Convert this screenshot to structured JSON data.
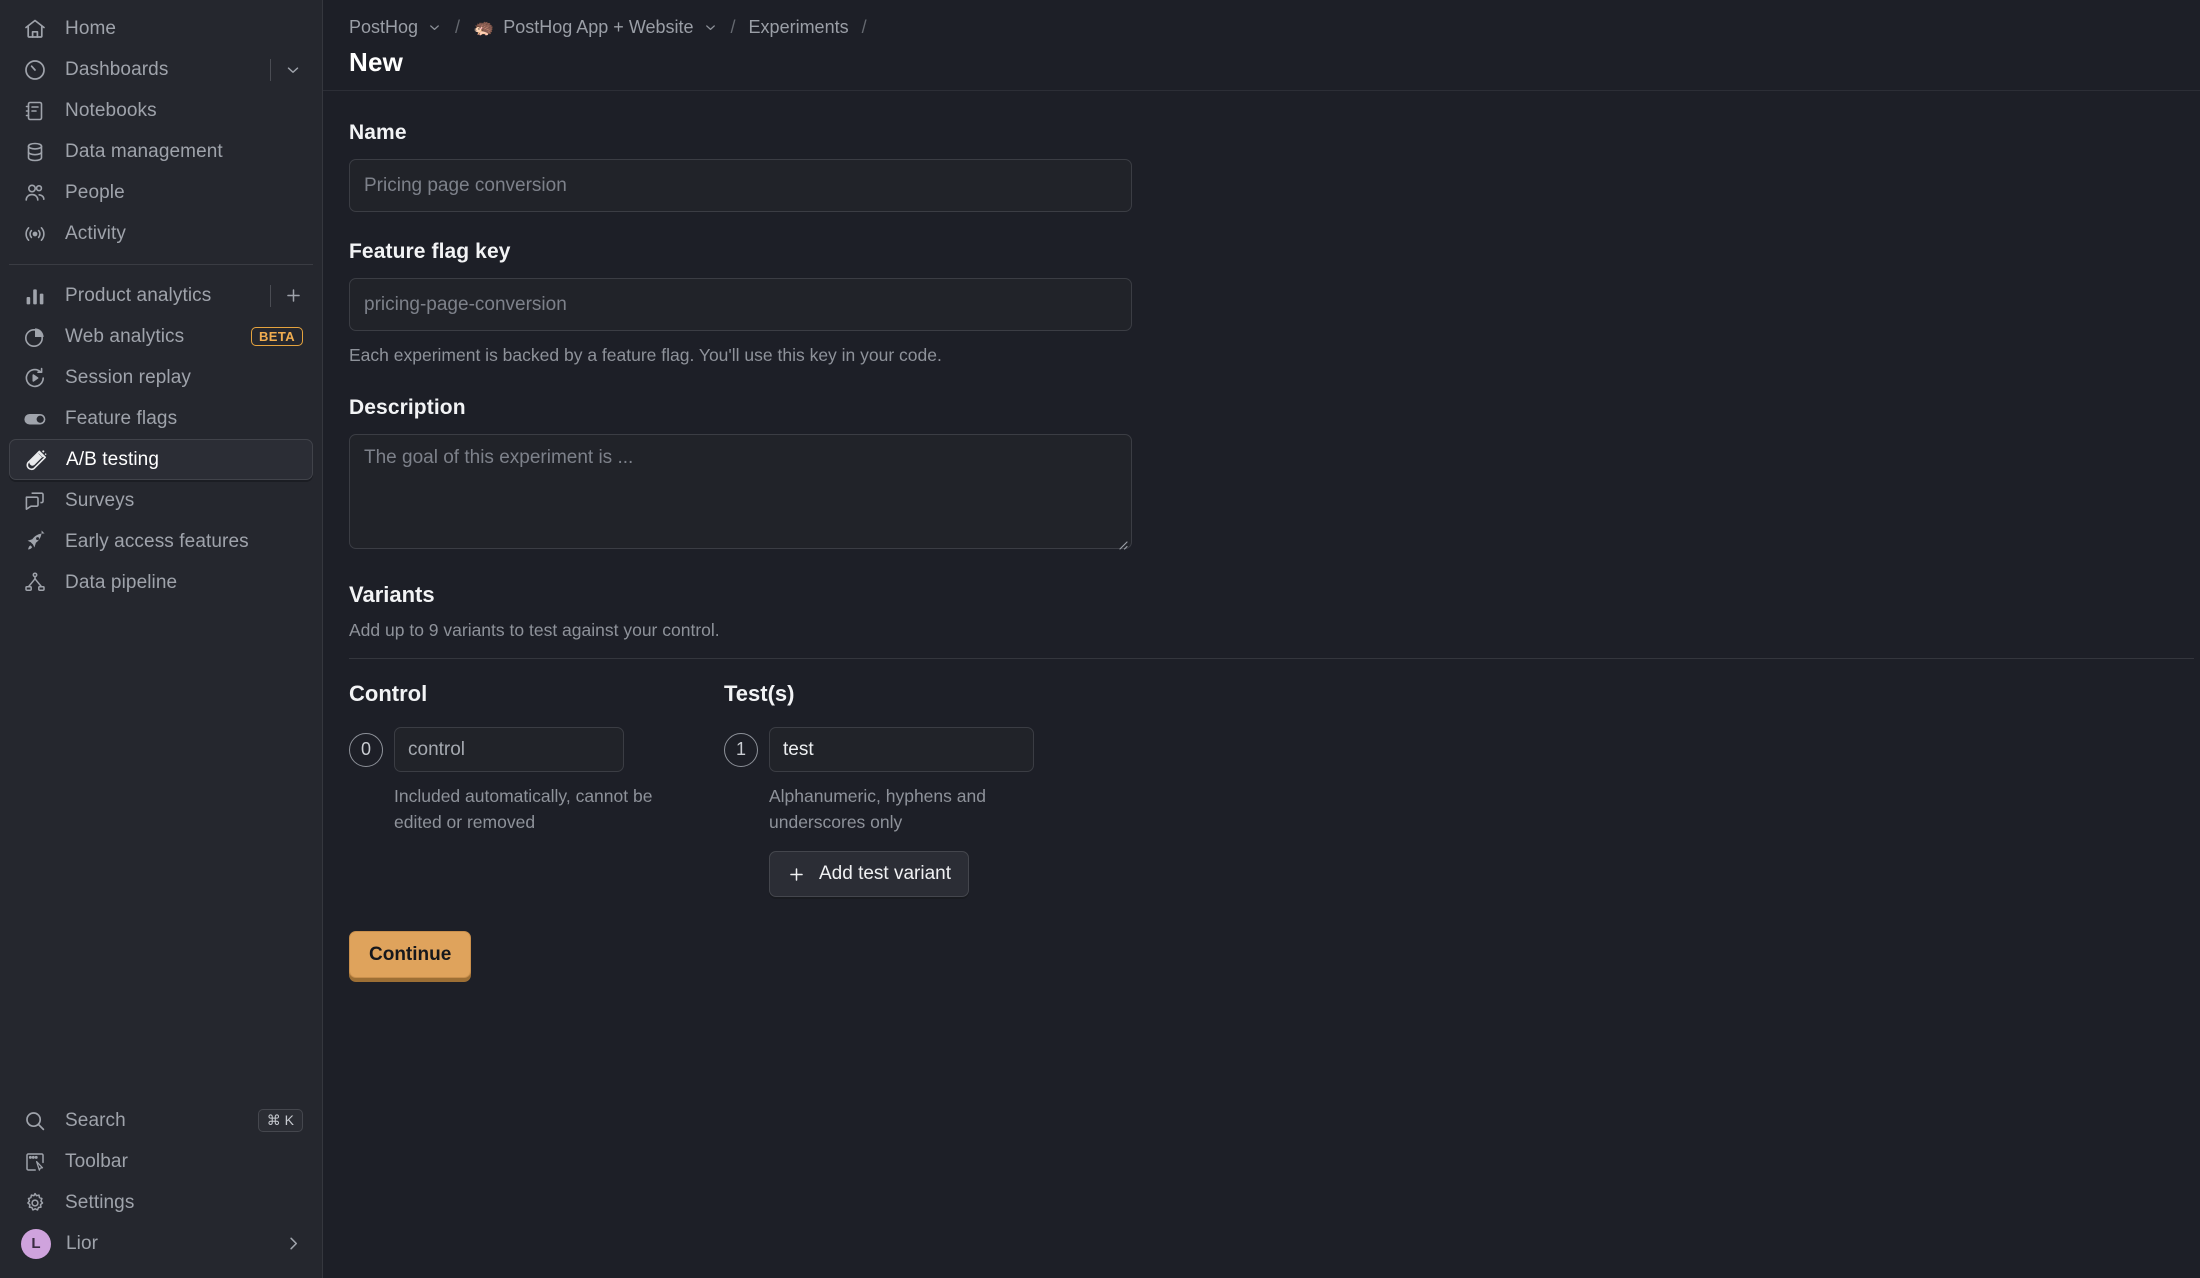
{
  "sidebar": {
    "primary_items": [
      {
        "label": "Home",
        "icon": "home-icon"
      },
      {
        "label": "Dashboards",
        "icon": "gauge-icon",
        "trailing": "caret"
      },
      {
        "label": "Notebooks",
        "icon": "notebook-icon"
      },
      {
        "label": "Data management",
        "icon": "database-icon"
      },
      {
        "label": "People",
        "icon": "people-icon"
      },
      {
        "label": "Activity",
        "icon": "activity-icon"
      }
    ],
    "product_items": [
      {
        "label": "Product analytics",
        "icon": "bar-chart-icon",
        "trailing": "plus"
      },
      {
        "label": "Web analytics",
        "icon": "pie-chart-icon",
        "badge": "BETA"
      },
      {
        "label": "Session replay",
        "icon": "play-circle-icon"
      },
      {
        "label": "Feature flags",
        "icon": "toggle-icon"
      },
      {
        "label": "A/B testing",
        "icon": "flask-icon",
        "active": true
      },
      {
        "label": "Surveys",
        "icon": "chat-icon"
      },
      {
        "label": "Early access features",
        "icon": "rocket-icon"
      },
      {
        "label": "Data pipeline",
        "icon": "pipeline-icon"
      }
    ],
    "bottom_items": [
      {
        "label": "Search",
        "icon": "search-icon",
        "shortcut": "⌘ K"
      },
      {
        "label": "Toolbar",
        "icon": "toolbar-icon"
      },
      {
        "label": "Settings",
        "icon": "gear-icon"
      }
    ],
    "user": {
      "name": "Lior",
      "initial": "L",
      "chevron": "›"
    }
  },
  "breadcrumb": {
    "org": "PostHog",
    "project": "PostHog App + Website",
    "project_emoji": "🦔",
    "section": "Experiments",
    "separator": "/",
    "caret": "˅"
  },
  "page": {
    "title": "New"
  },
  "form": {
    "name": {
      "label": "Name",
      "value": "",
      "placeholder": "Pricing page conversion"
    },
    "feature_flag_key": {
      "label": "Feature flag key",
      "value": "",
      "placeholder": "pricing-page-conversion",
      "help": "Each experiment is backed by a feature flag. You'll use this key in your code."
    },
    "description": {
      "label": "Description",
      "value": "",
      "placeholder": "The goal of this experiment is ..."
    }
  },
  "variants": {
    "title": "Variants",
    "subtitle": "Add up to 9 variants to test against your control.",
    "control": {
      "title": "Control",
      "index": "0",
      "value": "control",
      "help": "Included automatically, cannot be edited or removed"
    },
    "tests": {
      "title": "Test(s)",
      "items": [
        {
          "index": "1",
          "value": "test"
        }
      ],
      "help": "Alphanumeric, hyphens and underscores only",
      "add_label": "Add test variant",
      "add_icon": "plus-icon"
    }
  },
  "actions": {
    "continue_label": "Continue"
  },
  "colors": {
    "page_bg": "#1d1f27",
    "sidebar_bg": "#25272e",
    "accent": "#dfa35c",
    "beta_badge": "#f0ad50",
    "avatar": "#cfa3dd"
  }
}
